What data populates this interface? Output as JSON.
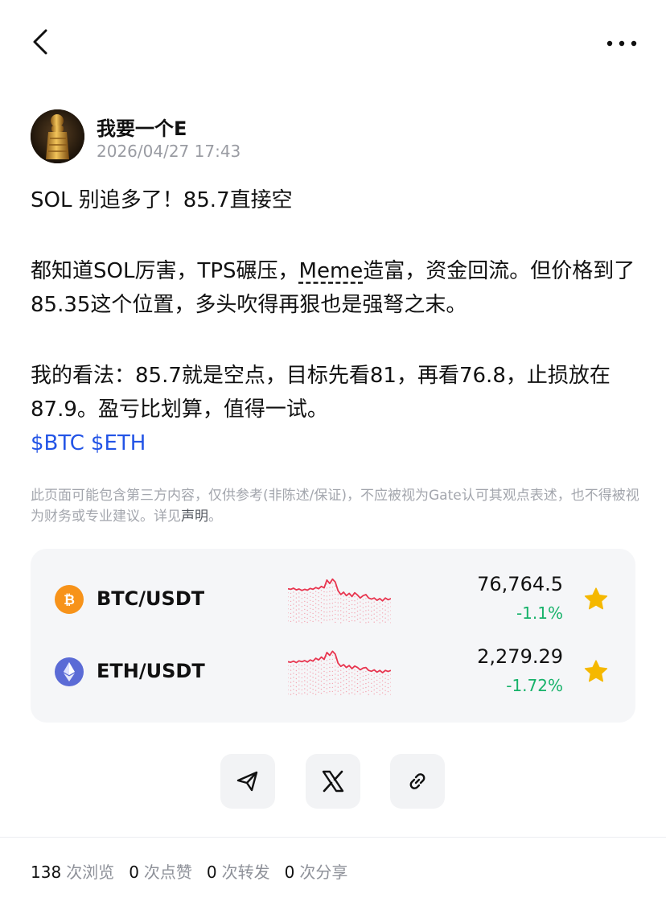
{
  "author": {
    "name": "我要一个E",
    "time": "2026/04/27 17:43"
  },
  "post": {
    "title": "SOL 别追多了！85.7直接空",
    "para2_before": "都知道SOL厉害，TPS碾压，",
    "para2_link": "Meme",
    "para2_after": "造富，资金回流。但价格到了85.35这个位置，多头吹得再狠也是强弩之末。",
    "para3": "我的看法：85.7就是空点，目标先看81，再看76.8，止损放在87.9。盈亏比划算，值得一试。",
    "tags": [
      "$BTC",
      "$ETH"
    ]
  },
  "disclaimer": {
    "text": "此页面可能包含第三方内容，仅供参考(非陈述/保证)，不应被视为Gate认可其观点表述，也不得被视为财务或专业建议。详见",
    "link": "声明",
    "end": "。"
  },
  "markets": [
    {
      "pair": "BTC/USDT",
      "price": "76,764.5",
      "change": "-1.1%",
      "icon": "bitcoin-icon",
      "icon_color": "#f7931a",
      "favorited": true,
      "spark": [
        0.62,
        0.6,
        0.64,
        0.58,
        0.61,
        0.56,
        0.6,
        0.57,
        0.63,
        0.6,
        0.66,
        0.62,
        0.7,
        0.65,
        0.92,
        0.8,
        0.95,
        0.85,
        0.55,
        0.42,
        0.5,
        0.38,
        0.46,
        0.35,
        0.48,
        0.4,
        0.3,
        0.38,
        0.42,
        0.3,
        0.26,
        0.3,
        0.22,
        0.28,
        0.2,
        0.3,
        0.24,
        0.28
      ]
    },
    {
      "pair": "ETH/USDT",
      "price": "2,279.29",
      "change": "-1.72%",
      "icon": "ethereum-icon",
      "icon_color": "#5b6bd6",
      "favorited": true,
      "spark": [
        0.6,
        0.58,
        0.62,
        0.57,
        0.63,
        0.6,
        0.64,
        0.59,
        0.66,
        0.62,
        0.72,
        0.66,
        0.76,
        0.68,
        0.92,
        0.82,
        0.96,
        0.86,
        0.55,
        0.44,
        0.5,
        0.4,
        0.47,
        0.36,
        0.45,
        0.4,
        0.32,
        0.38,
        0.4,
        0.3,
        0.27,
        0.32,
        0.24,
        0.3,
        0.22,
        0.3,
        0.26,
        0.3
      ]
    }
  ],
  "colors": {
    "spark_line": "#e8354f",
    "up_down_text": "#17b26a",
    "star": "#f5b800",
    "tag": "#2354e6"
  },
  "stats": [
    {
      "num": "138",
      "label": "次浏览"
    },
    {
      "num": "0",
      "label": "次点赞"
    },
    {
      "num": "0",
      "label": "次转发"
    },
    {
      "num": "0",
      "label": "次分享"
    }
  ]
}
